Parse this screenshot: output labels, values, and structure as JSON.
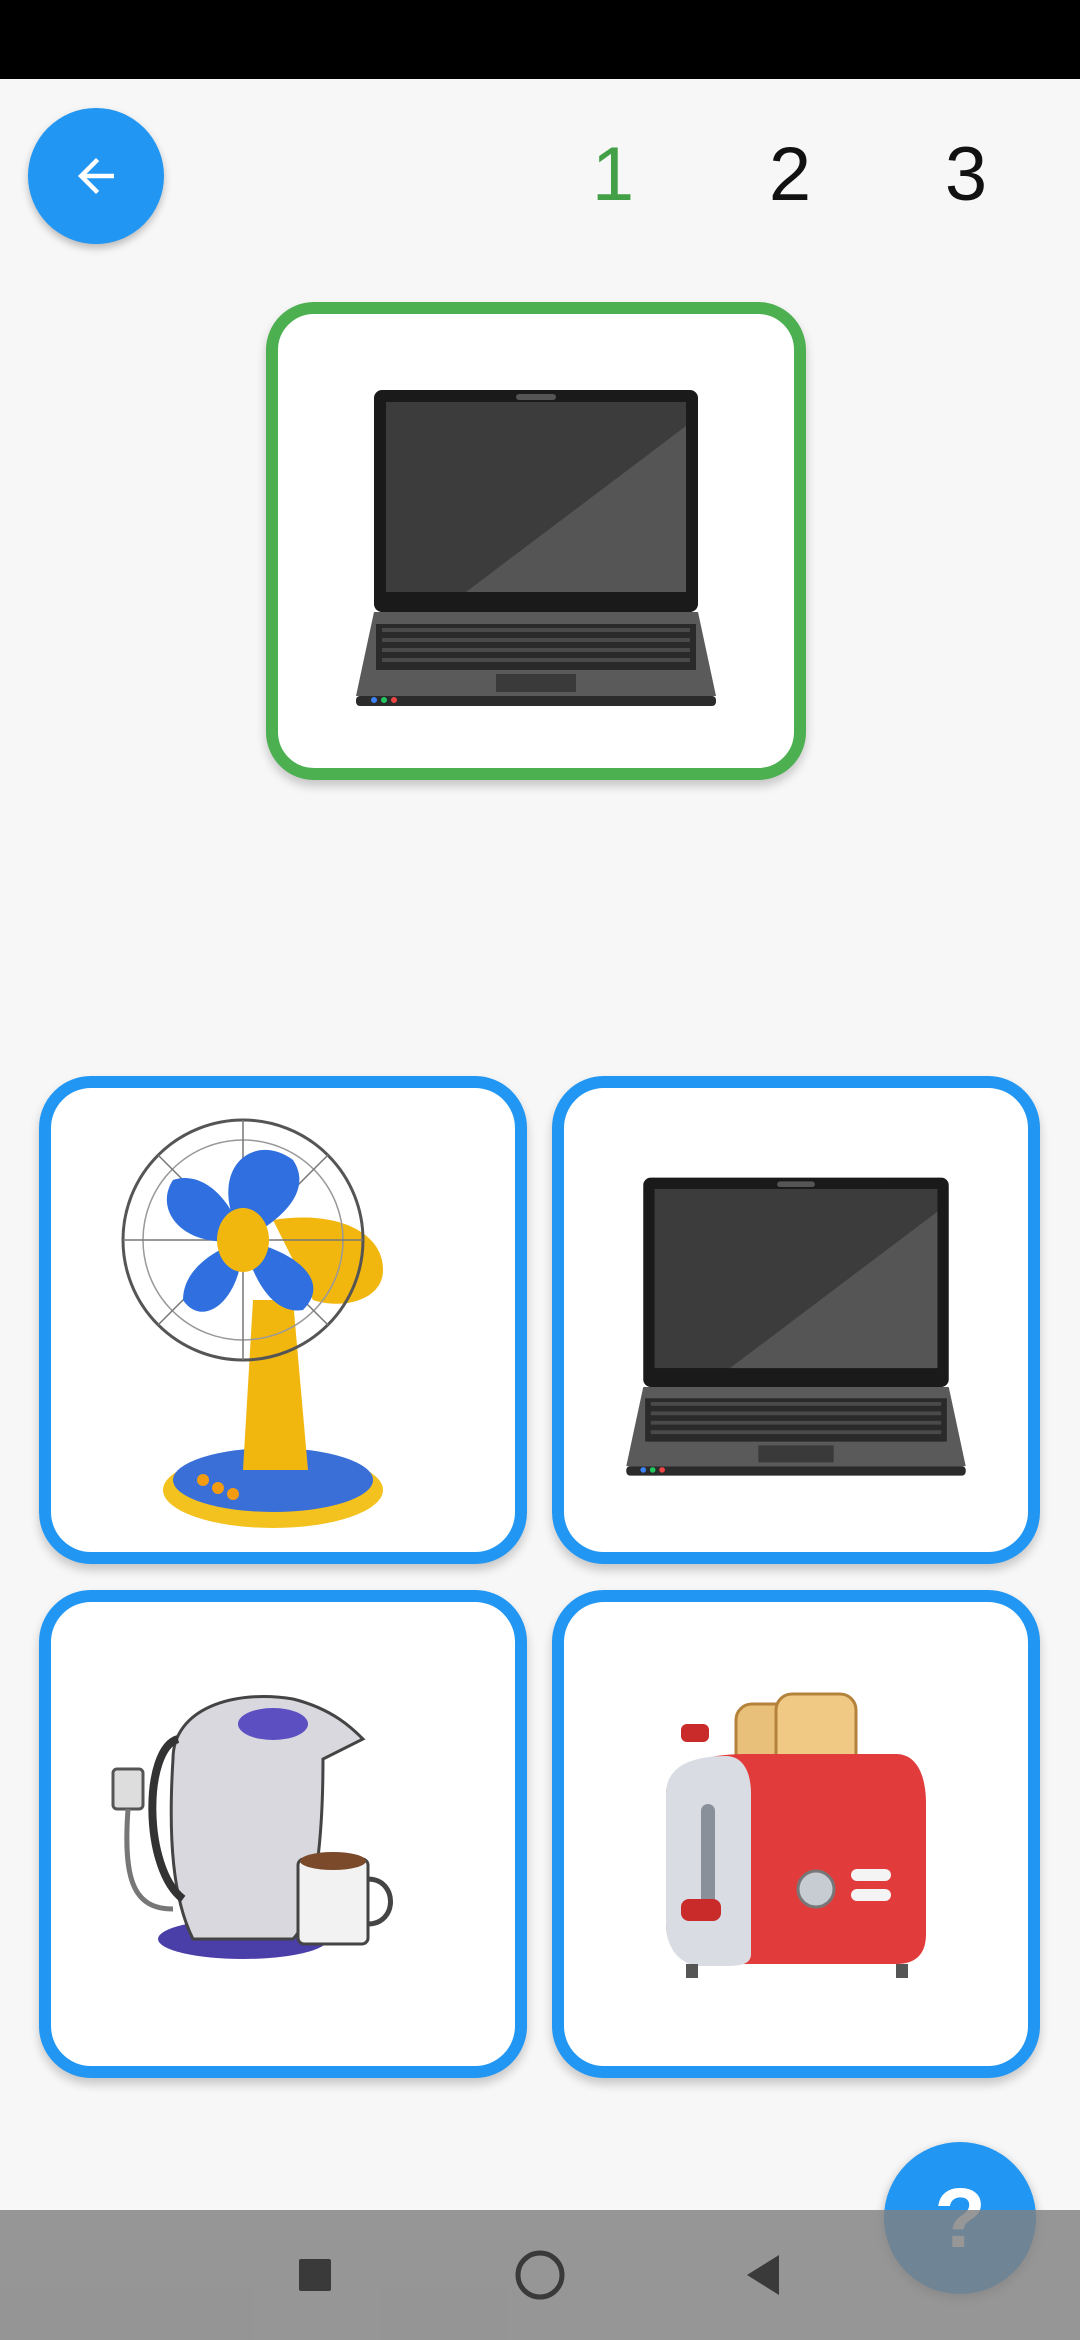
{
  "steps": [
    {
      "label": "1",
      "state": "current"
    },
    {
      "label": "2",
      "state": "upcoming"
    },
    {
      "label": "3",
      "state": "upcoming"
    }
  ],
  "target": {
    "item": "laptop"
  },
  "options": [
    {
      "item": "electric-fan"
    },
    {
      "item": "laptop"
    },
    {
      "item": "electric-kettle"
    },
    {
      "item": "toaster"
    }
  ],
  "help": {
    "label": "?"
  },
  "colors": {
    "accent": "#2196f3",
    "target_border": "#4caf50",
    "current_step": "#43a047",
    "background": "#f7f7f7"
  },
  "icons": {
    "back": "arrow-left-icon",
    "nav": [
      "recents-square-icon",
      "home-circle-icon",
      "back-triangle-icon"
    ]
  }
}
